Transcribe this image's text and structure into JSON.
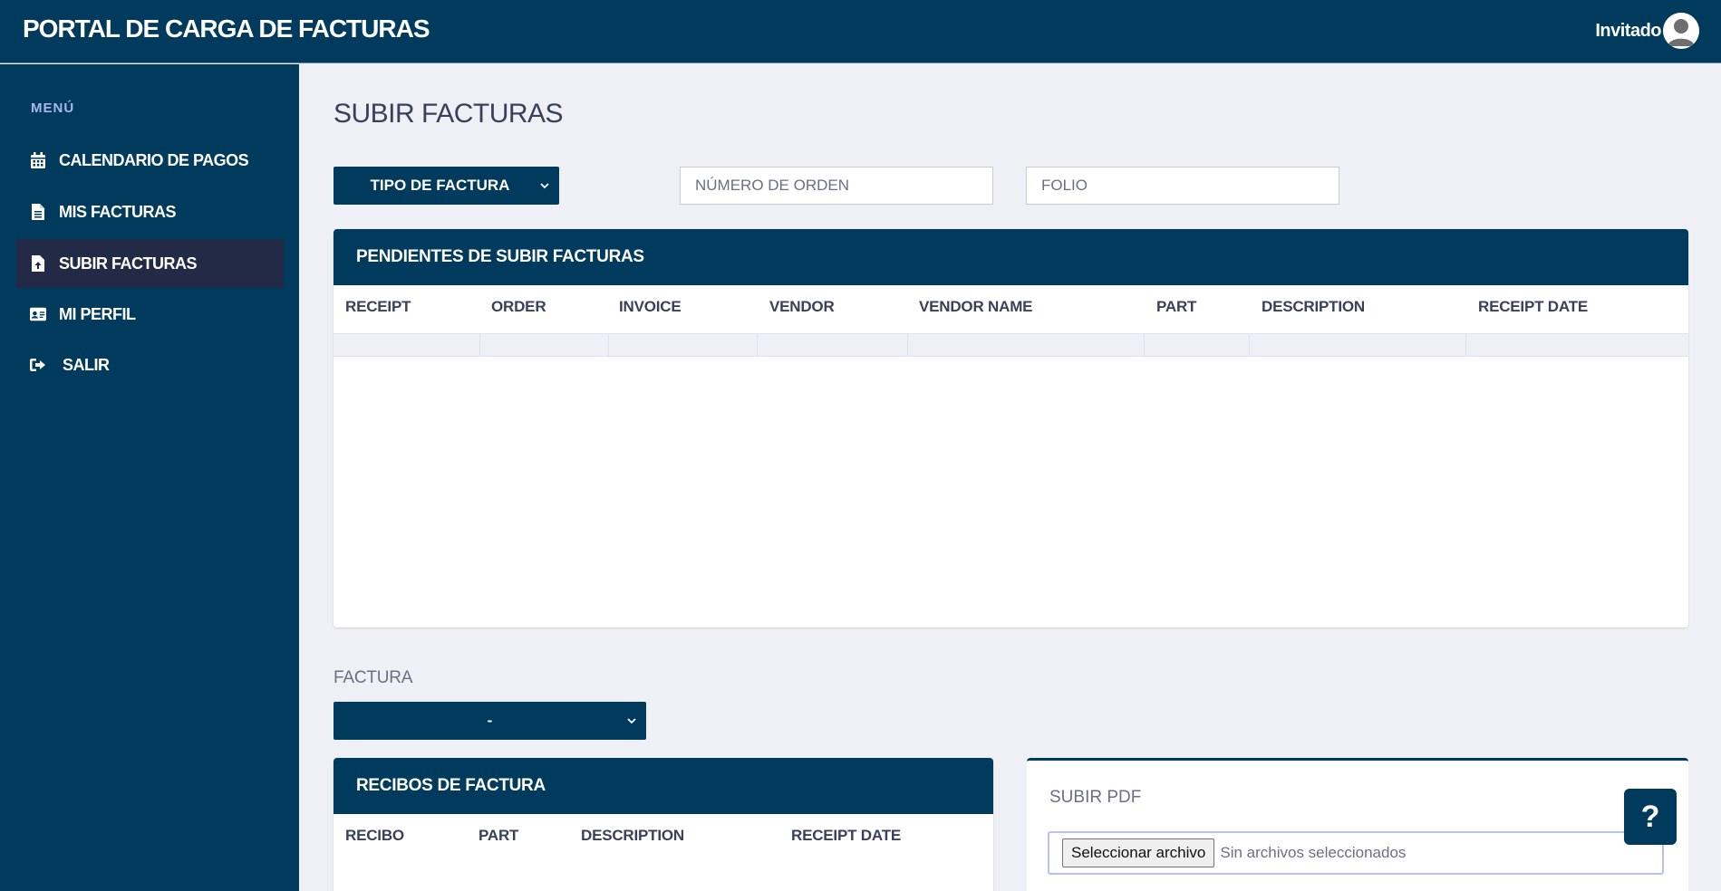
{
  "header": {
    "app_title": "PORTAL DE CARGA DE FACTURAS",
    "user_name": "Invitado"
  },
  "sidebar": {
    "menu_title": "MENÚ",
    "items": [
      {
        "label": "CALENDARIO DE PAGOS",
        "icon": "calendar-icon"
      },
      {
        "label": "MIS FACTURAS",
        "icon": "document-icon"
      },
      {
        "label": "SUBIR FACTURAS",
        "icon": "file-upload-icon",
        "active": true
      },
      {
        "label": "MI PERFIL",
        "icon": "id-card-icon"
      },
      {
        "label": "SALIR",
        "icon": "sign-out-icon"
      }
    ]
  },
  "main": {
    "page_title": "SUBIR FACTURAS",
    "filters": {
      "invoice_type_label": "TIPO DE FACTURA",
      "order_number_placeholder": "NÚMERO DE ORDEN",
      "folio_placeholder": "FOLIO"
    },
    "pending_table": {
      "title": "PENDIENTES DE SUBIR FACTURAS",
      "columns": [
        "RECEIPT",
        "ORDER",
        "INVOICE",
        "VENDOR",
        "VENDOR NAME",
        "PART",
        "DESCRIPTION",
        "RECEIPT DATE"
      ]
    },
    "factura": {
      "label": "FACTURA",
      "selected": "-"
    },
    "receipts_table": {
      "title": "RECIBOS DE FACTURA",
      "columns": [
        "RECIBO",
        "PART",
        "DESCRIPTION",
        "RECEIPT DATE"
      ]
    },
    "pdf_upload": {
      "title": "SUBIR PDF",
      "button_label": "Seleccionar archivo",
      "status": "Sin archivos seleccionados"
    },
    "help_label": "?"
  },
  "colors": {
    "navy": "#003a5d",
    "active_item": "#232a46",
    "background": "#eef0f5"
  }
}
